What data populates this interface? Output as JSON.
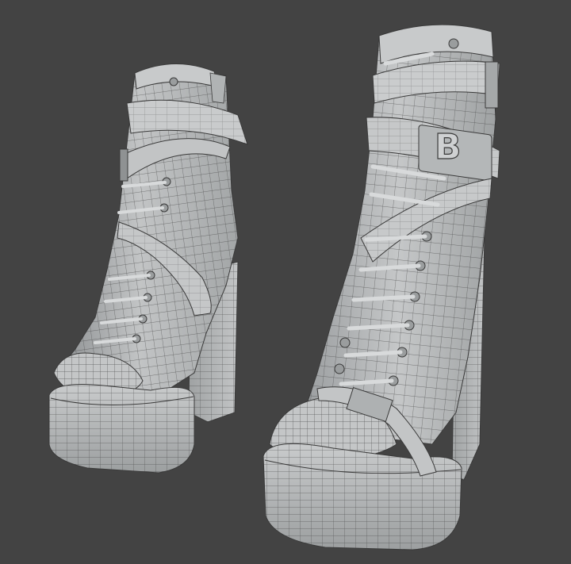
{
  "scene": {
    "background_color": "#434343",
    "mesh_fill": "#b9bcbd",
    "mesh_shadow": "#8d9092",
    "wire_color": "#3a3a3a",
    "highlight": "#d6d8d9"
  },
  "objects": {
    "left_boot": "boot-mesh",
    "right_boot": "boot-mesh"
  },
  "buckle_letters": "B"
}
